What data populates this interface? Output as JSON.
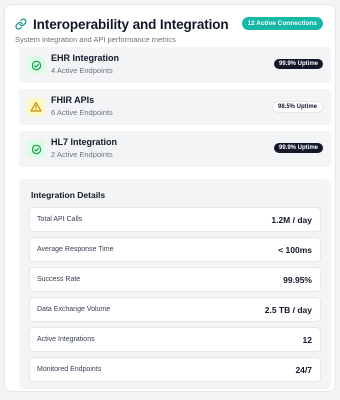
{
  "header": {
    "title": "Interoperability and Integration",
    "subtitle": "System integration and API performance metrics",
    "connections_badge": "12 Active Connections",
    "icon": "link-icon"
  },
  "systems": [
    {
      "name": "EHR Integration",
      "endpoints": "4 Active Endpoints",
      "uptime": "99.9% Uptime",
      "status": "success",
      "icon": "check-circle-icon"
    },
    {
      "name": "FHIR APIs",
      "endpoints": "6 Active Endpoints",
      "uptime": "98.5% Uptime",
      "status": "warning",
      "icon": "warning-triangle-icon"
    },
    {
      "name": "HL7 Integration",
      "endpoints": "2 Active Endpoints",
      "uptime": "99.9% Uptime",
      "status": "success",
      "icon": "check-circle-icon"
    }
  ],
  "details": {
    "title": "Integration Details",
    "metrics": [
      {
        "label": "Total API Calls",
        "value": "1.2M / day"
      },
      {
        "label": "Average Response Time",
        "value": "< 100ms"
      },
      {
        "label": "Success Rate",
        "value": "99.95%"
      },
      {
        "label": "Data Exchange Volume",
        "value": "2.5 TB / day"
      },
      {
        "label": "Active Integrations",
        "value": "12"
      },
      {
        "label": "Monitored Endpoints",
        "value": "24/7"
      }
    ]
  },
  "colors": {
    "accent": "#14b8a6",
    "success": "#16a34a",
    "success_bg": "#dcfce7",
    "warning": "#ca8a04",
    "warning_bg": "#fef9c3"
  }
}
